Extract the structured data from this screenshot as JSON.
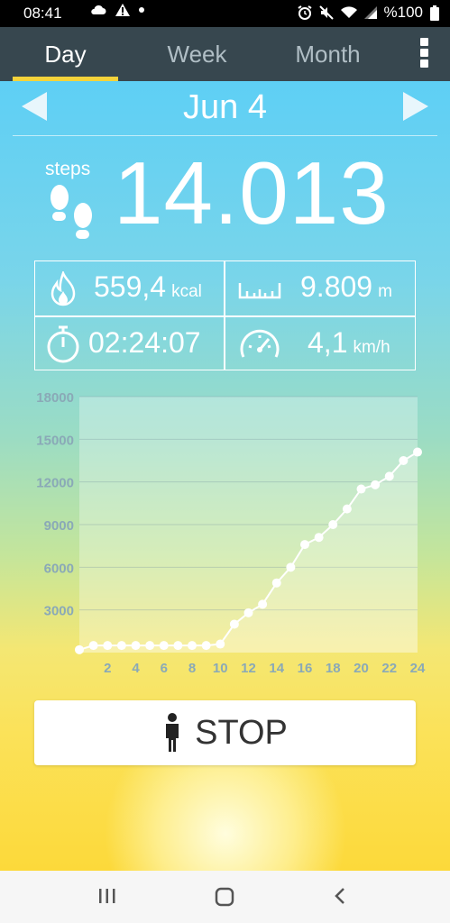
{
  "status_bar": {
    "time": "08:41",
    "battery": "%100",
    "left_icons": [
      "cloud-icon",
      "warning-icon",
      "dot-icon"
    ],
    "right_icons": [
      "alarm-icon",
      "mute-icon",
      "wifi-icon",
      "signal-icon",
      "battery-icon"
    ]
  },
  "tabs": [
    {
      "label": "Day",
      "active": true
    },
    {
      "label": "Week",
      "active": false
    },
    {
      "label": "Month",
      "active": false
    }
  ],
  "menu_icon": "more-vert-icon",
  "date": "Jun 4",
  "steps": {
    "label": "steps",
    "value": "14.013"
  },
  "stats": {
    "calories": {
      "value": "559,4",
      "unit": "kcal",
      "icon": "flame-icon"
    },
    "distance": {
      "value": "9.809",
      "unit": "m",
      "icon": "ruler-icon"
    },
    "duration": {
      "value": "02:24:07",
      "icon": "stopwatch-icon"
    },
    "speed": {
      "value": "4,1",
      "unit": "km/h",
      "icon": "speedometer-icon"
    }
  },
  "chart_data": {
    "type": "line",
    "x": [
      0,
      1,
      2,
      3,
      4,
      5,
      6,
      7,
      8,
      9,
      10,
      11,
      12,
      13,
      14,
      15,
      16,
      17,
      18,
      19,
      20,
      21,
      22,
      23,
      24
    ],
    "values": [
      200,
      500,
      500,
      500,
      500,
      500,
      500,
      500,
      500,
      500,
      600,
      2000,
      2800,
      3400,
      4900,
      6000,
      7600,
      8100,
      9000,
      10100,
      11500,
      11800,
      12400,
      13500,
      14100
    ],
    "yticks": [
      "3000",
      "6000",
      "9000",
      "12000",
      "15000",
      "18000"
    ],
    "xticks": [
      "2",
      "4",
      "6",
      "8",
      "10",
      "12",
      "14",
      "16",
      "18",
      "20",
      "22",
      "24"
    ],
    "ylim": [
      0,
      18000
    ],
    "xlim": [
      0,
      24
    ],
    "grid": true,
    "colors": {
      "line": "#ffffff",
      "axis_text": "#8aa9b7",
      "grid": "rgba(120,150,160,0.35)",
      "plot_bg": "rgba(255,255,255,0.3)"
    }
  },
  "stop_button": {
    "label": "STOP",
    "icon": "person-icon"
  },
  "nav_bar": {
    "recents": "recents-icon",
    "home": "home-icon",
    "back": "back-icon"
  }
}
